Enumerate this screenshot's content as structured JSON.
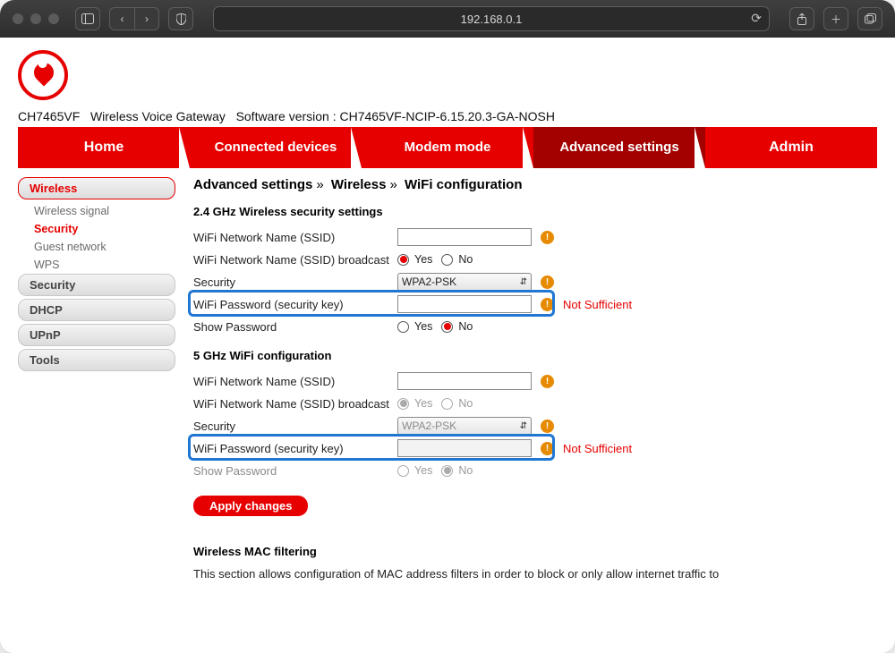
{
  "browser": {
    "url": "192.168.0.1"
  },
  "device": {
    "model": "CH7465VF",
    "type": "Wireless Voice Gateway",
    "sw_label": "Software version :",
    "sw_version": "CH7465VF-NCIP-6.15.20.3-GA-NOSH"
  },
  "tabs": [
    "Home",
    "Connected devices",
    "Modem mode",
    "Advanced settings",
    "Admin"
  ],
  "sidebar": {
    "wireless": "Wireless",
    "wireless_sub": [
      "Wireless signal",
      "Security",
      "Guest network",
      "WPS"
    ],
    "security": "Security",
    "dhcp": "DHCP",
    "upnp": "UPnP",
    "tools": "Tools"
  },
  "breadcrumb": {
    "a": "Advanced settings",
    "b": "Wireless",
    "c": "WiFi configuration",
    "sep": "»"
  },
  "sect24": "2.4 GHz Wireless security settings",
  "sect5": "5 GHz WiFi configuration",
  "labels": {
    "ssid": "WiFi Network Name (SSID)",
    "bcast": "WiFi Network Name (SSID) broadcast",
    "sec": "Security",
    "pwd": "WiFi Password (security key)",
    "show": "Show Password"
  },
  "radio": {
    "yes": "Yes",
    "no": "No"
  },
  "sec_option": "WPA2-PSK",
  "not_sufficient": "Not Sufficient",
  "apply": "Apply changes",
  "mac": {
    "title": "Wireless MAC filtering",
    "text": "This section allows configuration of MAC address filters in order to block or only allow internet traffic to"
  }
}
